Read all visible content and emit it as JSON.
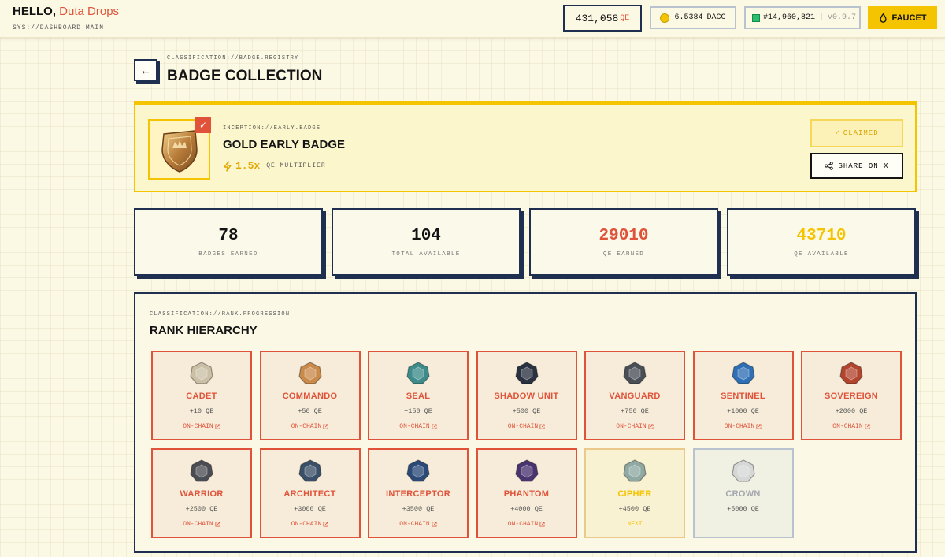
{
  "header": {
    "greeting": "HELLO,",
    "user_name": "Duta Drops",
    "sys_path": "SYS://DASHBOARD.MAIN",
    "qe_balance": "431,058",
    "qe_unit": "QE",
    "dacc_balance": "6.5384",
    "dacc_unit": "DACC",
    "block": "#14,960,821",
    "version": "v0.9.7",
    "faucet_label": "FAUCET"
  },
  "page": {
    "classification": "CLASSIFICATION://BADGE.REGISTRY",
    "title": "BADGE COLLECTION"
  },
  "featured_badge": {
    "classification": "INCEPTION://EARLY.BADGE",
    "name": "GOLD EARLY BADGE",
    "multiplier": "1.5x",
    "multiplier_label": "QE MULTIPLIER",
    "claimed_label": "CLAIMED",
    "share_label": "SHARE ON X"
  },
  "stats": [
    {
      "value": "78",
      "label": "BADGES EARNED",
      "color": "#141414"
    },
    {
      "value": "104",
      "label": "TOTAL AVAILABLE",
      "color": "#141414"
    },
    {
      "value": "29010",
      "label": "QE EARNED",
      "color": "#e0533a"
    },
    {
      "value": "43710",
      "label": "QE AVAILABLE",
      "color": "#f5c400"
    }
  ],
  "ranks": {
    "classification": "CLASSIFICATION://RANK.PROGRESSION",
    "title": "RANK HIERARCHY",
    "items": [
      {
        "name": "CADET",
        "qe": "+10 QE",
        "status": "ON-CHAIN",
        "state": "earned",
        "icon": "cadet-badge-icon",
        "color": "#cbbfa6"
      },
      {
        "name": "COMMANDO",
        "qe": "+50 QE",
        "status": "ON-CHAIN",
        "state": "earned",
        "icon": "commando-badge-icon",
        "color": "#c98a4a"
      },
      {
        "name": "SEAL",
        "qe": "+150 QE",
        "status": "ON-CHAIN",
        "state": "earned",
        "icon": "seal-badge-icon",
        "color": "#3d8b8b"
      },
      {
        "name": "SHADOW UNIT",
        "qe": "+500 QE",
        "status": "ON-CHAIN",
        "state": "earned",
        "icon": "shadow-unit-badge-icon",
        "color": "#2a3140"
      },
      {
        "name": "VANGUARD",
        "qe": "+750 QE",
        "status": "ON-CHAIN",
        "state": "earned",
        "icon": "vanguard-badge-icon",
        "color": "#4a4f57"
      },
      {
        "name": "SENTINEL",
        "qe": "+1000 QE",
        "status": "ON-CHAIN",
        "state": "earned",
        "icon": "sentinel-badge-icon",
        "color": "#2f6fb5"
      },
      {
        "name": "SOVEREIGN",
        "qe": "+2000 QE",
        "status": "ON-CHAIN",
        "state": "earned",
        "icon": "sovereign-badge-icon",
        "color": "#b3452f"
      },
      {
        "name": "WARRIOR",
        "qe": "+2500 QE",
        "status": "ON-CHAIN",
        "state": "earned",
        "icon": "warrior-badge-icon",
        "color": "#4b4d54"
      },
      {
        "name": "ARCHITECT",
        "qe": "+3000 QE",
        "status": "ON-CHAIN",
        "state": "earned",
        "icon": "architect-badge-icon",
        "color": "#3a5068"
      },
      {
        "name": "INTERCEPTOR",
        "qe": "+3500 QE",
        "status": "ON-CHAIN",
        "state": "earned",
        "icon": "interceptor-badge-icon",
        "color": "#2b4a78"
      },
      {
        "name": "PHANTOM",
        "qe": "+4000 QE",
        "status": "ON-CHAIN",
        "state": "earned",
        "icon": "phantom-badge-icon",
        "color": "#4a3470"
      },
      {
        "name": "CIPHER",
        "qe": "+4500 QE",
        "status": "NEXT",
        "state": "next",
        "icon": "cipher-badge-icon",
        "color": "#8fa8a2"
      },
      {
        "name": "CROWN",
        "qe": "+5000 QE",
        "status": "",
        "state": "locked",
        "icon": "crown-badge-icon",
        "color": "#d5d8d6"
      }
    ]
  }
}
